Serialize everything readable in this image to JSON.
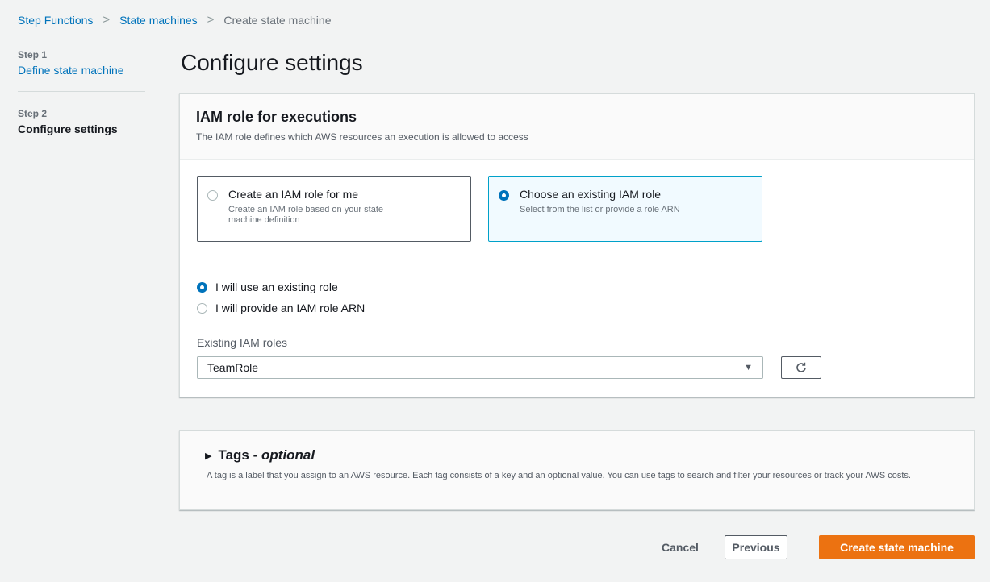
{
  "breadcrumb": {
    "items": [
      "Step Functions",
      "State machines"
    ],
    "current": "Create state machine",
    "separator": ">"
  },
  "steps": [
    {
      "num": "Step 1",
      "label": "Define state machine"
    },
    {
      "num": "Step 2",
      "label": "Configure settings"
    }
  ],
  "page_title": "Configure settings",
  "iam": {
    "title": "IAM role for executions",
    "description": "The IAM role defines which AWS resources an execution is allowed to access",
    "tiles": [
      {
        "title": "Create an IAM role for me",
        "desc_line1": "Create an IAM role based on your state",
        "desc_line2": "machine definition",
        "selected": false
      },
      {
        "title": "Choose an existing IAM role",
        "desc_line1": "Select from the list or provide a role ARN",
        "desc_line2": "",
        "selected": true
      }
    ],
    "options": [
      {
        "label": "I will use an existing role",
        "selected": true
      },
      {
        "label": "I will provide an IAM role ARN",
        "selected": false
      }
    ],
    "field_label": "Existing IAM roles",
    "selected_role": "TeamRole"
  },
  "tags": {
    "title": "Tags - ",
    "title_emph": "optional",
    "description": "A tag is a label that you assign to an AWS resource. Each tag consists of a key and an optional value. You can use tags to search and filter your resources or track your AWS costs."
  },
  "actions": {
    "cancel": "Cancel",
    "previous": "Previous",
    "create": "Create state machine"
  },
  "colors": {
    "link": "#0073bb",
    "primary": "#ec7211",
    "selected_border": "#00a1c9",
    "selected_bg": "#f1faff"
  },
  "icons": {
    "caret": "caret-down-icon",
    "refresh": "refresh-icon",
    "expand": "caret-right-icon",
    "separator": "chevron-right-icon"
  }
}
